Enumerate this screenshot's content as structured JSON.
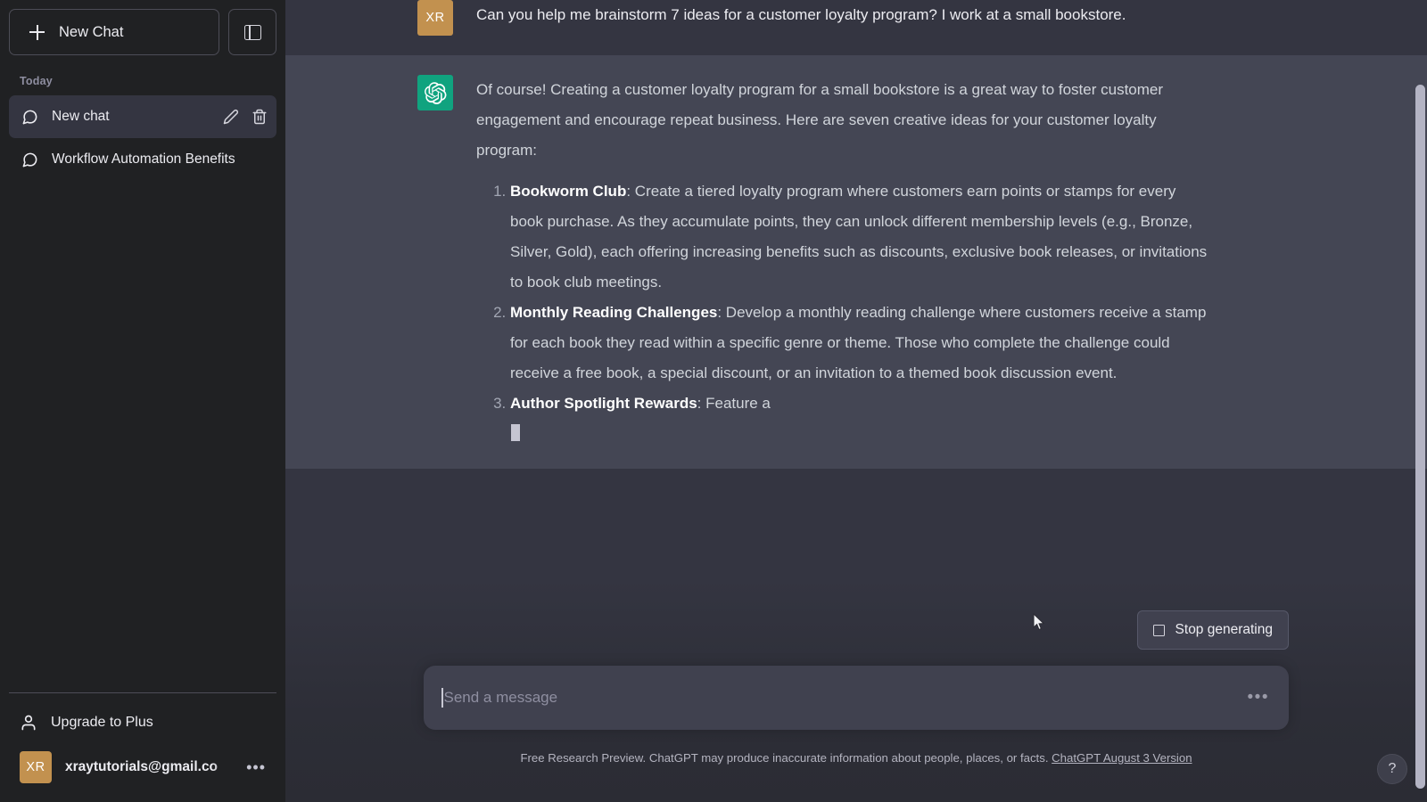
{
  "sidebar": {
    "new_chat_label": "New Chat",
    "new_chat_icon": "plus-icon",
    "collapse_icon": "panel-left-icon",
    "section_label": "Today",
    "chats": [
      {
        "title": "New chat",
        "icon": "message-icon",
        "active": true,
        "edit_icon": "pencil-icon",
        "delete_icon": "trash-icon"
      },
      {
        "title": "Workflow Automation Benefits",
        "icon": "message-icon",
        "active": false
      }
    ],
    "upgrade_label": "Upgrade to Plus",
    "upgrade_icon": "person-icon",
    "account_name": "xraytutorials@gmail.co",
    "account_initials": "XR",
    "account_menu_icon": "ellipsis-icon"
  },
  "conversation": {
    "messages": [
      {
        "role": "user",
        "avatar_initials": "XR",
        "text": "Can you help me brainstorm 7 ideas for a customer loyalty program? I work at a small bookstore."
      },
      {
        "role": "assistant",
        "avatar_icon": "openai-logo-icon",
        "intro": "Of course! Creating a customer loyalty program for a small bookstore is a great way to foster customer engagement and encourage repeat business. Here are seven creative ideas for your customer loyalty program:",
        "items": [
          {
            "title": "Bookworm Club",
            "body": ": Create a tiered loyalty program where customers earn points or stamps for every book purchase. As they accumulate points, they can unlock different membership levels (e.g., Bronze, Silver, Gold), each offering increasing benefits such as discounts, exclusive book releases, or invitations to book club meetings."
          },
          {
            "title": "Monthly Reading Challenges",
            "body": ": Develop a monthly reading challenge where customers receive a stamp for each book they read within a specific genre or theme. Those who complete the challenge could receive a free book, a special discount, or an invitation to a themed book discussion event."
          },
          {
            "title": "Author Spotlight Rewards",
            "body": ": Feature a"
          }
        ],
        "streaming": true
      }
    ]
  },
  "composer": {
    "stop_label": "Stop generating",
    "stop_icon": "stop-square-icon",
    "placeholder": "Send a message",
    "value": "",
    "send_icon": "ellipsis-icon"
  },
  "footer": {
    "note": "Free Research Preview. ChatGPT may produce inaccurate information about people, places, or facts.",
    "version_link": "ChatGPT August 3 Version"
  },
  "help": {
    "label": "?",
    "icon": "question-mark-icon"
  },
  "colors": {
    "sidebar_bg": "#202123",
    "user_msg_bg": "#343541",
    "assistant_msg_bg": "#444654",
    "brand_green": "#10a37f",
    "avatar_gold": "#c2914f"
  }
}
